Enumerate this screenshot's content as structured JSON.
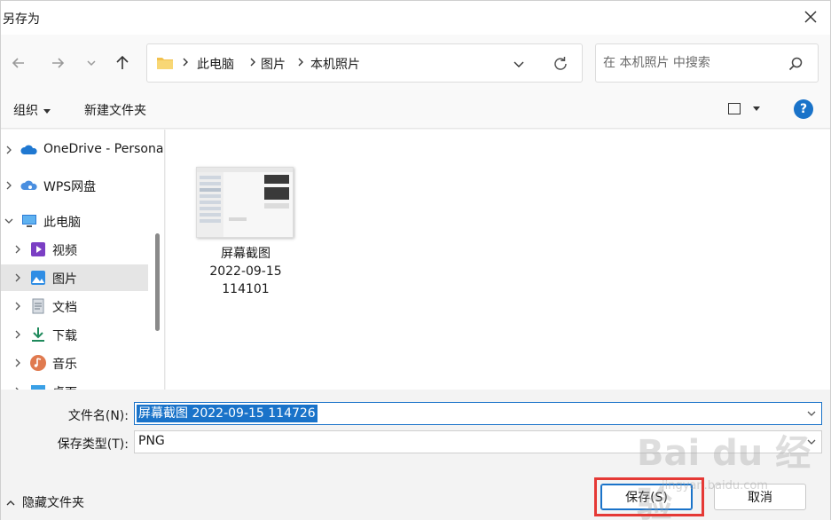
{
  "window": {
    "title": "另存为"
  },
  "address": {
    "crumbs": [
      "此电脑",
      "图片",
      "本机照片"
    ]
  },
  "search": {
    "placeholder": "在 本机照片 中搜索"
  },
  "toolbar": {
    "organize": "组织",
    "new_folder": "新建文件夹",
    "help": "?"
  },
  "sidebar": {
    "items": [
      {
        "label": "OneDrive - Personal"
      },
      {
        "label": "WPS网盘"
      },
      {
        "label": "此电脑"
      },
      {
        "label": "视频"
      },
      {
        "label": "图片"
      },
      {
        "label": "文档"
      },
      {
        "label": "下载"
      },
      {
        "label": "音乐"
      },
      {
        "label": "桌面"
      }
    ]
  },
  "files": [
    {
      "name_line1": "屏幕截图",
      "name_line2": "2022-09-15",
      "name_line3": "114101"
    }
  ],
  "form": {
    "filename_label": "文件名(N):",
    "filename_value": "屏幕截图 2022-09-15 114726",
    "type_label": "保存类型(T):",
    "type_value": "PNG"
  },
  "footer": {
    "hide_folders": "隐藏文件夹",
    "save": "保存(S)",
    "cancel": "取消"
  },
  "watermark": {
    "brand": "Bai du 经验",
    "url": "jingyan.baidu.com"
  },
  "colors": {
    "accent": "#1a73c9",
    "selection": "#e5e5e5",
    "highlight_box": "#e53935"
  }
}
